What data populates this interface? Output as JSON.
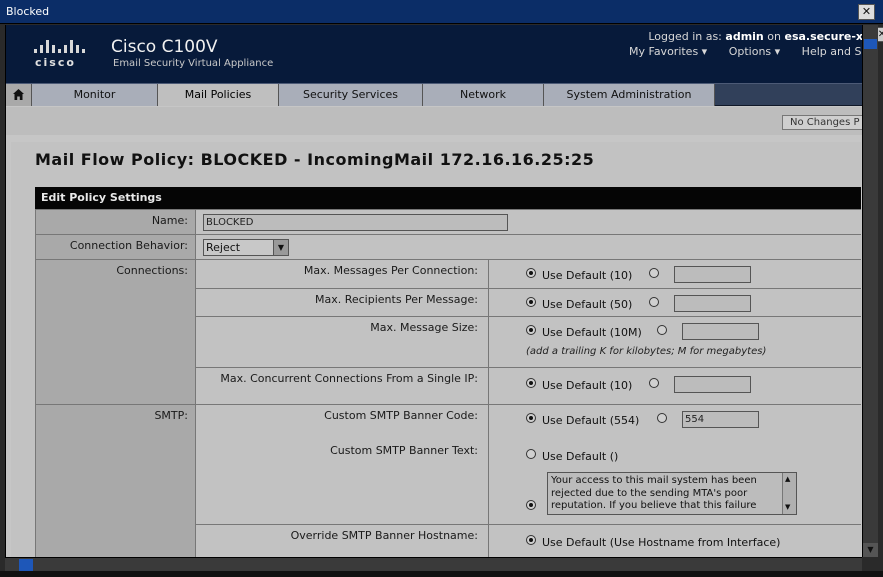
{
  "window": {
    "title": "Blocked",
    "close_glyph": "✕"
  },
  "header": {
    "brand": "cisco",
    "product": "Cisco C100V",
    "subtitle": "Email Security Virtual Appliance",
    "logged_prefix": "Logged in as:",
    "user": "admin",
    "on_word": "on",
    "host": "esa.secure-x",
    "links": [
      "My Favorites ▾",
      "Options ▾",
      "Help and Sup"
    ]
  },
  "nav": {
    "tabs": [
      "Monitor",
      "Mail Policies",
      "Security Services",
      "Network",
      "System Administration"
    ],
    "active": "Mail Policies"
  },
  "toolbar": {
    "no_changes": "No Changes P"
  },
  "page": {
    "title": "Mail Flow Policy: BLOCKED - IncomingMail 172.16.16.25:25",
    "section": "Edit Policy Settings"
  },
  "form": {
    "name": {
      "label": "Name:",
      "value": "BLOCKED"
    },
    "behavior": {
      "label": "Connection Behavior:",
      "value": "Reject"
    },
    "connections": {
      "label": "Connections:",
      "rows": [
        {
          "label": "Max. Messages Per Connection:",
          "default": "Use Default (10)"
        },
        {
          "label": "Max. Recipients Per Message:",
          "default": "Use Default (50)"
        },
        {
          "label": "Max. Message Size:",
          "default": "Use Default (10M)",
          "hint": "(add a trailing K for kilobytes; M for megabytes)"
        },
        {
          "label": "Max. Concurrent Connections From a Single IP:",
          "default": "Use Default (10)"
        }
      ]
    },
    "smtp": {
      "label": "SMTP:",
      "banner_code": {
        "label": "Custom SMTP Banner Code:",
        "default": "Use Default (554)",
        "value": "554"
      },
      "banner_text": {
        "label": "Custom SMTP Banner Text:",
        "default": "Use Default ()",
        "value": "Your access to this mail system has been rejected due to the sending MTA's poor reputation. If you believe that this failure"
      },
      "hostname": {
        "label": "Override SMTP Banner Hostname:",
        "default": "Use Default (Use Hostname from Interface)"
      }
    }
  },
  "colors": {
    "header_bg": "#071a3a",
    "nav_bg": "#31405a",
    "scroll_thumb": "#1e57b8"
  }
}
